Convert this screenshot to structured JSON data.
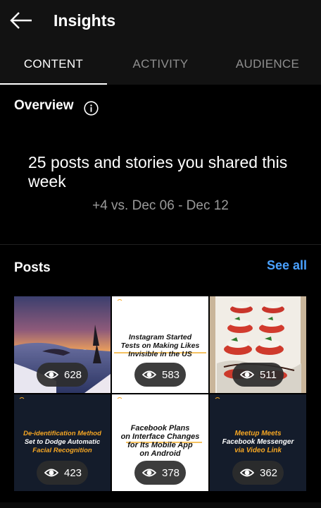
{
  "header": {
    "title": "Insights",
    "back_icon": "arrow-left-icon"
  },
  "tabs": [
    {
      "label": "CONTENT",
      "active": true
    },
    {
      "label": "ACTIVITY",
      "active": false
    },
    {
      "label": "AUDIENCE",
      "active": false
    }
  ],
  "overview": {
    "title": "Overview",
    "summary": "25 posts and stories you shared this week",
    "comparison": "+4 vs. Dec 06 - Dec 12"
  },
  "posts": {
    "title": "Posts",
    "see_all": "See all",
    "items": [
      {
        "views": "628",
        "kind": "landscape-photo"
      },
      {
        "views": "583",
        "kind": "text-card",
        "text_lines": [
          "Instagram Started",
          "Tests on Making Likes",
          "Invisible in the US"
        ]
      },
      {
        "views": "511",
        "kind": "food-photo"
      },
      {
        "views": "423",
        "kind": "text-card",
        "text_lines": [
          "De-identification Method",
          "Set to Dodge Automatic",
          "Facial Recognition"
        ]
      },
      {
        "views": "378",
        "kind": "text-card",
        "text_lines": [
          "Facebook Plans",
          "on Interface Changes",
          "for Its Mobile App",
          "on Android"
        ]
      },
      {
        "views": "362",
        "kind": "text-card",
        "text_lines": [
          "Meetup Meets",
          "Facebook Messenger",
          "via Video Link"
        ]
      }
    ]
  },
  "colors": {
    "accent": "#4aa1ff",
    "background": "#000000",
    "bar": "#121212",
    "muted": "#8f8f8f",
    "highlight_orange": "#f5a623"
  }
}
